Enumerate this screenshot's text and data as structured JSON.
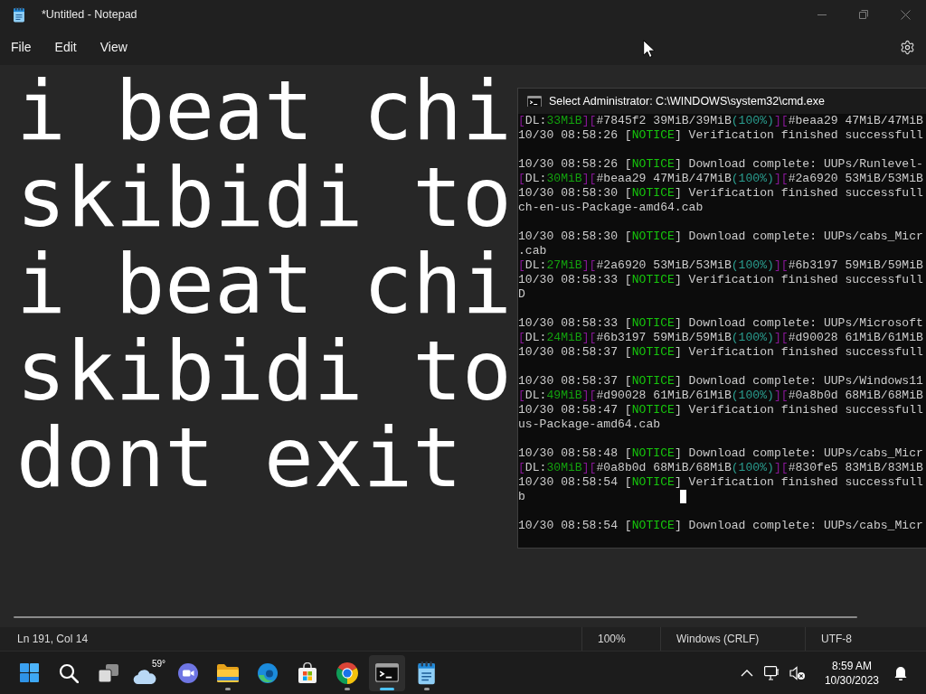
{
  "notepad": {
    "title": "*Untitled - Notepad",
    "menu": [
      "File",
      "Edit",
      "View"
    ],
    "lines": [
      "i beat chi",
      "skibidi to",
      "i beat chi",
      "skibidi to",
      "dont exit"
    ],
    "status": {
      "position": "Ln 191, Col 14",
      "zoom": "100%",
      "line_ending": "Windows (CRLF)",
      "encoding": "UTF-8"
    }
  },
  "console": {
    "title": "Select Administrator: C:\\WINDOWS\\system32\\cmd.exe",
    "blocks": [
      {
        "lines": [
          [
            {
              "text": "[",
              "kind": "bracket"
            },
            {
              "text": "DL:",
              "kind": "plain"
            },
            {
              "text": "33MiB",
              "kind": "speed"
            },
            {
              "text": "][",
              "kind": "bracket"
            },
            {
              "text": "#7845f2 39MiB/39MiB",
              "kind": "plain"
            },
            {
              "text": "(100%)",
              "kind": "percent"
            },
            {
              "text": "][",
              "kind": "bracket"
            },
            {
              "text": "#beaa29 47MiB/47MiB",
              "kind": "plain"
            }
          ],
          [
            {
              "text": "10/30 08:58:26 [",
              "kind": "plain"
            },
            {
              "text": "NOTICE",
              "kind": "notice"
            },
            {
              "text": "] Verification finished successfull",
              "kind": "plain"
            }
          ]
        ]
      },
      {
        "lines": [
          [
            {
              "text": "10/30 08:58:26 [",
              "kind": "plain"
            },
            {
              "text": "NOTICE",
              "kind": "notice"
            },
            {
              "text": "] Download complete: UUPs/Runlevel-",
              "kind": "plain"
            }
          ],
          [
            {
              "text": "[",
              "kind": "bracket"
            },
            {
              "text": "DL:",
              "kind": "plain"
            },
            {
              "text": "30MiB",
              "kind": "speed"
            },
            {
              "text": "][",
              "kind": "bracket"
            },
            {
              "text": "#beaa29 47MiB/47MiB",
              "kind": "plain"
            },
            {
              "text": "(100%)",
              "kind": "percent"
            },
            {
              "text": "][",
              "kind": "bracket"
            },
            {
              "text": "#2a6920 53MiB/53MiB",
              "kind": "plain"
            }
          ],
          [
            {
              "text": "10/30 08:58:30 [",
              "kind": "plain"
            },
            {
              "text": "NOTICE",
              "kind": "notice"
            },
            {
              "text": "] Verification finished successfull",
              "kind": "plain"
            }
          ],
          [
            {
              "text": "ch-en-us-Package-amd64.cab",
              "kind": "plain"
            }
          ]
        ]
      },
      {
        "lines": [
          [
            {
              "text": "10/30 08:58:30 [",
              "kind": "plain"
            },
            {
              "text": "NOTICE",
              "kind": "notice"
            },
            {
              "text": "] Download complete: UUPs/cabs_Micr",
              "kind": "plain"
            }
          ],
          [
            {
              "text": ".cab",
              "kind": "plain"
            }
          ],
          [
            {
              "text": "[",
              "kind": "bracket"
            },
            {
              "text": "DL:",
              "kind": "plain"
            },
            {
              "text": "27MiB",
              "kind": "speed"
            },
            {
              "text": "][",
              "kind": "bracket"
            },
            {
              "text": "#2a6920 53MiB/53MiB",
              "kind": "plain"
            },
            {
              "text": "(100%)",
              "kind": "percent"
            },
            {
              "text": "][",
              "kind": "bracket"
            },
            {
              "text": "#6b3197 59MiB/59MiB",
              "kind": "plain"
            }
          ],
          [
            {
              "text": "10/30 08:58:33 [",
              "kind": "plain"
            },
            {
              "text": "NOTICE",
              "kind": "notice"
            },
            {
              "text": "] Verification finished successfull",
              "kind": "plain"
            }
          ],
          [
            {
              "text": "D",
              "kind": "plain"
            }
          ]
        ]
      },
      {
        "lines": [
          [
            {
              "text": "10/30 08:58:33 [",
              "kind": "plain"
            },
            {
              "text": "NOTICE",
              "kind": "notice"
            },
            {
              "text": "] Download complete: UUPs/Microsoft",
              "kind": "plain"
            }
          ],
          [
            {
              "text": "[",
              "kind": "bracket"
            },
            {
              "text": "DL:",
              "kind": "plain"
            },
            {
              "text": "24MiB",
              "kind": "speed"
            },
            {
              "text": "][",
              "kind": "bracket"
            },
            {
              "text": "#6b3197 59MiB/59MiB",
              "kind": "plain"
            },
            {
              "text": "(100%)",
              "kind": "percent"
            },
            {
              "text": "][",
              "kind": "bracket"
            },
            {
              "text": "#d90028 61MiB/61MiB",
              "kind": "plain"
            }
          ],
          [
            {
              "text": "10/30 08:58:37 [",
              "kind": "plain"
            },
            {
              "text": "NOTICE",
              "kind": "notice"
            },
            {
              "text": "] Verification finished successfull",
              "kind": "plain"
            }
          ]
        ]
      },
      {
        "lines": [
          [
            {
              "text": "10/30 08:58:37 [",
              "kind": "plain"
            },
            {
              "text": "NOTICE",
              "kind": "notice"
            },
            {
              "text": "] Download complete: UUPs/Windows11",
              "kind": "plain"
            }
          ],
          [
            {
              "text": "[",
              "kind": "bracket"
            },
            {
              "text": "DL:",
              "kind": "plain"
            },
            {
              "text": "49MiB",
              "kind": "speed"
            },
            {
              "text": "][",
              "kind": "bracket"
            },
            {
              "text": "#d90028 61MiB/61MiB",
              "kind": "plain"
            },
            {
              "text": "(100%)",
              "kind": "percent"
            },
            {
              "text": "][",
              "kind": "bracket"
            },
            {
              "text": "#0a8b0d 68MiB/68MiB",
              "kind": "plain"
            }
          ],
          [
            {
              "text": "10/30 08:58:47 [",
              "kind": "plain"
            },
            {
              "text": "NOTICE",
              "kind": "notice"
            },
            {
              "text": "] Verification finished successfull",
              "kind": "plain"
            }
          ],
          [
            {
              "text": "us-Package-amd64.cab",
              "kind": "plain"
            }
          ]
        ]
      },
      {
        "lines": [
          [
            {
              "text": "10/30 08:58:48 [",
              "kind": "plain"
            },
            {
              "text": "NOTICE",
              "kind": "notice"
            },
            {
              "text": "] Download complete: UUPs/cabs_Micr",
              "kind": "plain"
            }
          ],
          [
            {
              "text": "[",
              "kind": "bracket"
            },
            {
              "text": "DL:",
              "kind": "plain"
            },
            {
              "text": "30MiB",
              "kind": "speed"
            },
            {
              "text": "][",
              "kind": "bracket"
            },
            {
              "text": "#0a8b0d 68MiB/68MiB",
              "kind": "plain"
            },
            {
              "text": "(100%)",
              "kind": "percent"
            },
            {
              "text": "][",
              "kind": "bracket"
            },
            {
              "text": "#830fe5 83MiB/83MiB",
              "kind": "plain"
            }
          ],
          [
            {
              "text": "10/30 08:58:54 [",
              "kind": "plain"
            },
            {
              "text": "NOTICE",
              "kind": "notice"
            },
            {
              "text": "] Verification finished successfull",
              "kind": "plain"
            }
          ],
          [
            {
              "text": "b",
              "kind": "plain"
            }
          ]
        ]
      },
      {
        "lines": [
          [
            {
              "text": "10/30 08:58:54 [",
              "kind": "plain"
            },
            {
              "text": "NOTICE",
              "kind": "notice"
            },
            {
              "text": "] Download complete: UUPs/cabs_Micr",
              "kind": "plain"
            }
          ]
        ]
      }
    ]
  },
  "taskbar": {
    "apps": [
      {
        "kind": "start",
        "running": false,
        "selected": false
      },
      {
        "kind": "search",
        "running": false,
        "selected": false
      },
      {
        "kind": "task_view",
        "running": false,
        "selected": false
      },
      {
        "kind": "weather",
        "label": "59°",
        "running": false,
        "selected": false
      },
      {
        "kind": "chat",
        "running": false,
        "selected": false
      },
      {
        "kind": "folder",
        "running": true,
        "selected": false
      },
      {
        "kind": "edge",
        "running": false,
        "selected": false
      },
      {
        "kind": "store",
        "running": false,
        "selected": false
      },
      {
        "kind": "chrome",
        "running": true,
        "selected": false
      },
      {
        "kind": "terminal",
        "running": true,
        "selected": true
      },
      {
        "kind": "notepad",
        "running": true,
        "selected": false
      }
    ],
    "clock": {
      "time": "8:59 AM",
      "date": "10/30/2023"
    }
  }
}
